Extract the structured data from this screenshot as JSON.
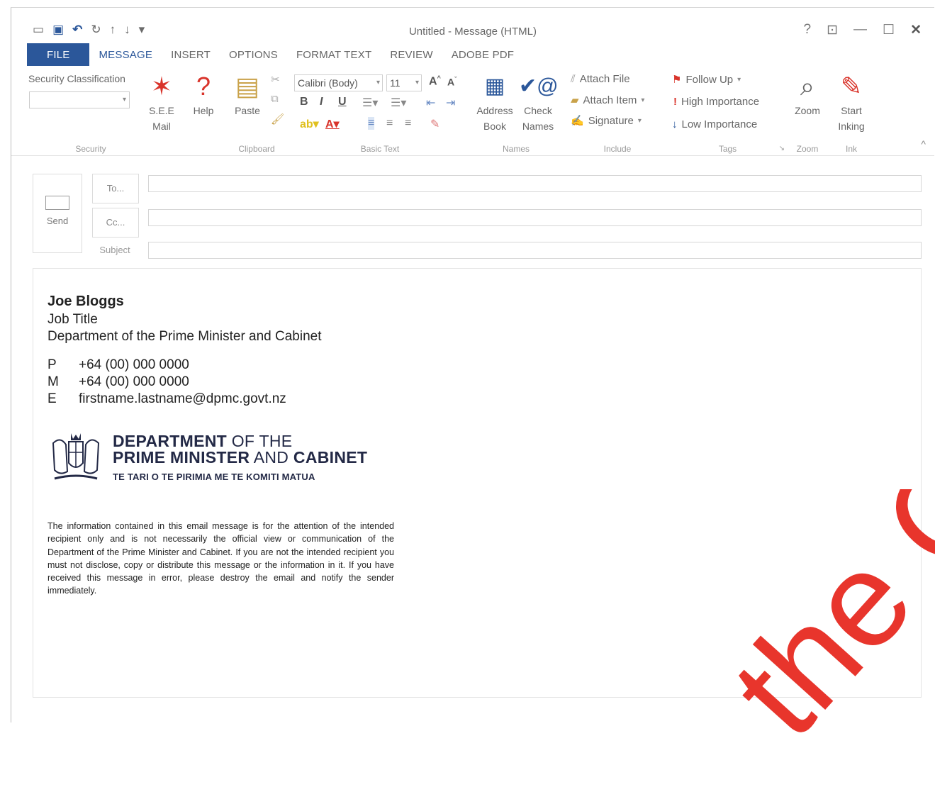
{
  "window": {
    "title": "Untitled - Message (HTML)"
  },
  "qat": {
    "email_icon": "envelope-icon",
    "save_icon": "save-icon",
    "undo_icon": "undo-icon",
    "redo_icon": "redo-icon",
    "up_icon": "up-arrow-icon",
    "down_icon": "down-arrow-icon",
    "customize": "▾"
  },
  "controls": {
    "help": "?",
    "ribbon_options": "⊡",
    "minimize": "—",
    "maximize": "☐",
    "close": "✕"
  },
  "tabs": [
    "FILE",
    "MESSAGE",
    "INSERT",
    "OPTIONS",
    "FORMAT TEXT",
    "REVIEW",
    "ADOBE PDF"
  ],
  "ribbon": {
    "security": {
      "label": "Security Classification",
      "group": "Security",
      "see_mail": "S.E.E Mail",
      "help": "Help"
    },
    "clipboard": {
      "paste": "Paste",
      "group": "Clipboard"
    },
    "basic_text": {
      "font": "Calibri (Body)",
      "size": "11",
      "bold": "B",
      "italic": "I",
      "underline": "U",
      "group": "Basic Text"
    },
    "names": {
      "address_book": "Address Book",
      "check_names": "Check Names",
      "group": "Names"
    },
    "include": {
      "attach_file": "Attach File",
      "attach_item": "Attach Item",
      "signature": "Signature",
      "group": "Include"
    },
    "tags": {
      "follow_up": "Follow Up",
      "high_importance": "High Importance",
      "low_importance": "Low Importance",
      "group": "Tags"
    },
    "zoom": {
      "label": "Zoom",
      "group": "Zoom"
    },
    "ink": {
      "label": "Start Inking",
      "group": "Ink"
    }
  },
  "compose": {
    "send": "Send",
    "to": "To...",
    "cc": "Cc...",
    "subject": "Subject",
    "to_value": "",
    "cc_value": "",
    "subject_value": ""
  },
  "signature": {
    "name": "Joe Bloggs",
    "job_title": "Job Title",
    "department": "Department of the Prime Minister and Cabinet",
    "contacts": [
      {
        "key": "P",
        "value": "+64 (00) 000 0000"
      },
      {
        "key": "M",
        "value": "+64 (00) 000 0000"
      },
      {
        "key": "E",
        "value": "firstname.lastname@dpmc.govt.nz"
      }
    ],
    "logo_bold_1": "DEPARTMENT",
    "logo_rest_1": " OF THE",
    "logo_bold_2": "PRIME MINISTER",
    "logo_mid_2": " AND ",
    "logo_bold_2b": "CABINET",
    "logo_maori": "TE TARI O TE PIRIMIA ME TE KOMITI MATUA",
    "disclaimer": "The information contained in this email message is for the attention of the intended recipient only and is not necessarily the official view or communication of the Department of the Prime Minister and Cabinet. If you are not the intended recipient you must not disclose, copy or distribute this message or the information in it. If you have received this message in error, please destroy the email and notify the sender immediately."
  },
  "watermark": {
    "text": "the Off",
    "color": "#e8352c"
  },
  "colors": {
    "accent": "#2b579a",
    "flag": "#d9342b"
  }
}
